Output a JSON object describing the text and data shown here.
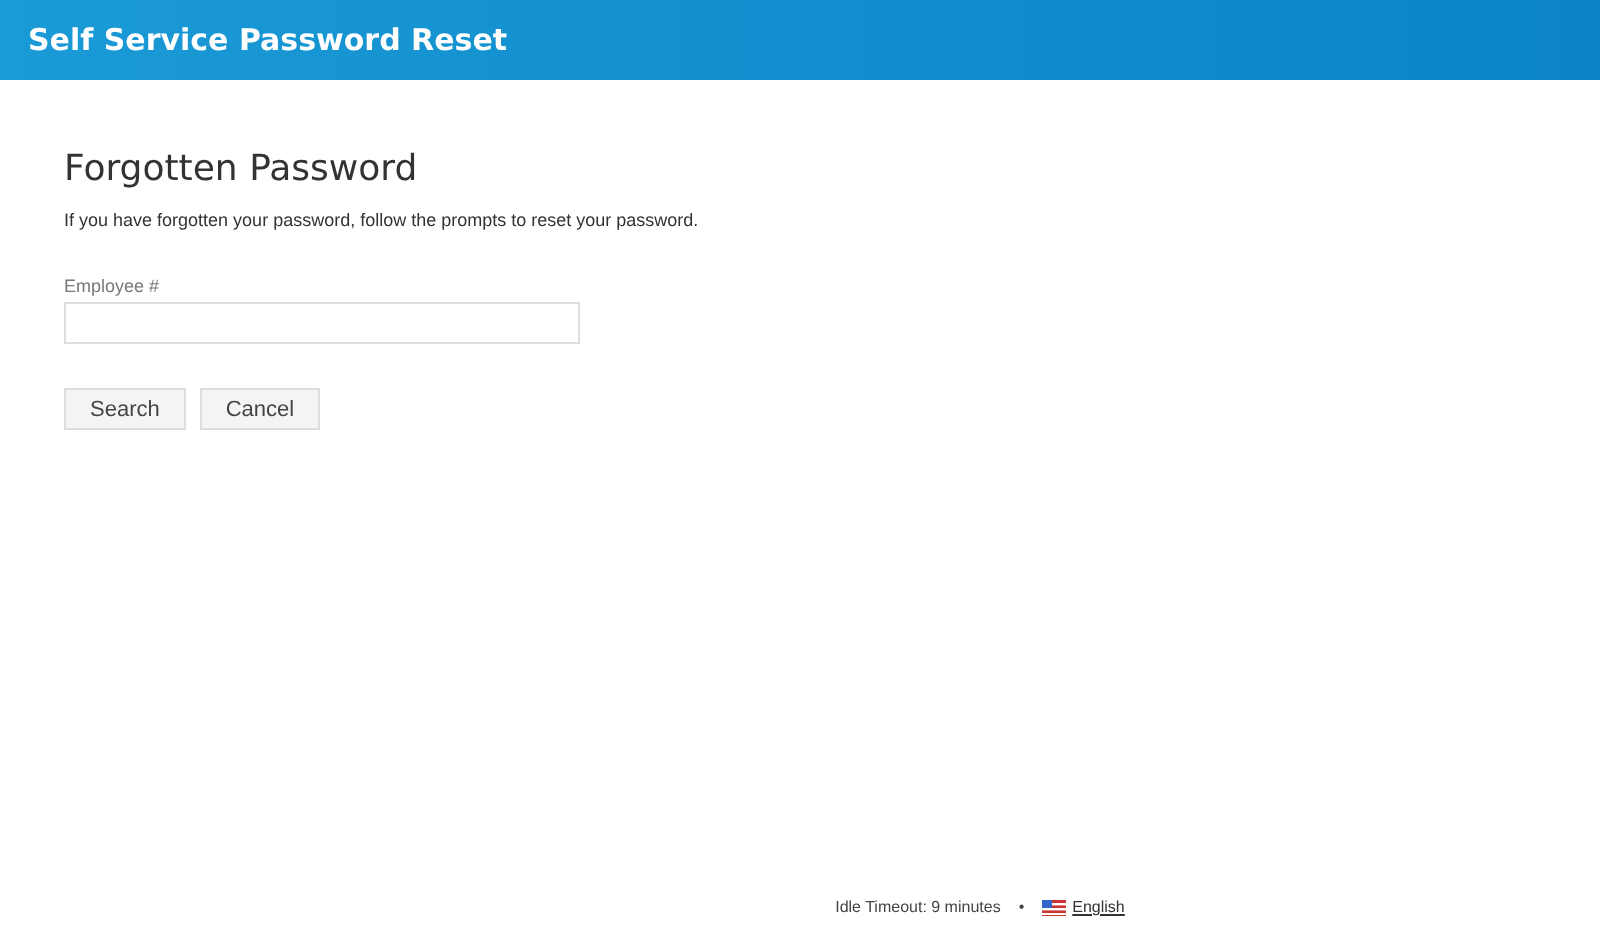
{
  "header": {
    "title": "Self Service Password Reset"
  },
  "page": {
    "heading": "Forgotten Password",
    "instructions": "If you have forgotten your password, follow the prompts to reset your password."
  },
  "field": {
    "label": "Employee #"
  },
  "buttons": [
    "Search",
    "Cancel"
  ],
  "footer": {
    "idle_timeout": "Idle Timeout: 9 minutes",
    "separator": "•",
    "language": "English"
  }
}
